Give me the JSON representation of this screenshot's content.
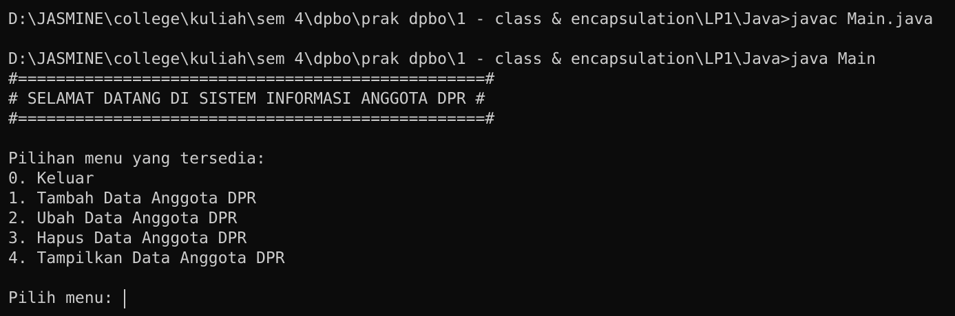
{
  "terminal": {
    "commands": [
      {
        "prompt": "D:\\JASMINE\\college\\kuliah\\sem 4\\dpbo\\prak dpbo\\1 - class & encapsulation\\LP1\\Java>",
        "command": "javac Main.java"
      },
      {
        "prompt": "D:\\JASMINE\\college\\kuliah\\sem 4\\dpbo\\prak dpbo\\1 - class & encapsulation\\LP1\\Java>",
        "command": "java Main"
      }
    ],
    "banner": {
      "top": "#=================================================#",
      "text": "# SELAMAT DATANG DI SISTEM INFORMASI ANGGOTA DPR #",
      "bottom": "#=================================================#"
    },
    "menu": {
      "title": "Pilihan menu yang tersedia:",
      "items": [
        "0. Keluar",
        "1. Tambah Data Anggota DPR",
        "2. Ubah Data Anggota DPR",
        "3. Hapus Data Anggota DPR",
        "4. Tampilkan Data Anggota DPR"
      ]
    },
    "input_prompt": "Pilih menu: "
  }
}
